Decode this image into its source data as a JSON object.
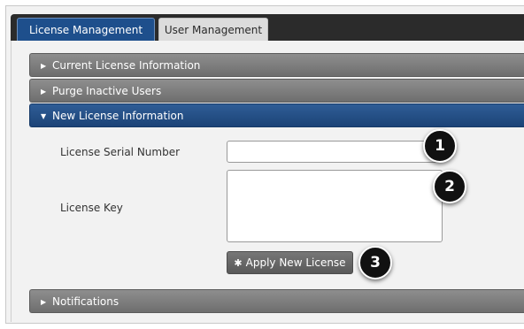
{
  "tabs": [
    {
      "label": "License Management"
    },
    {
      "label": "User Management"
    }
  ],
  "sections": [
    {
      "label": "Current License Information",
      "arrow": "▶"
    },
    {
      "label": "Purge Inactive Users",
      "arrow": "▶"
    },
    {
      "label": "New License Information",
      "arrow": "▼"
    },
    {
      "label": "Notifications",
      "arrow": "▶"
    }
  ],
  "form": {
    "serial_label": "License Serial Number",
    "serial_value": "",
    "key_label": "License Key",
    "key_value": "",
    "apply_label": "Apply New License",
    "apply_icon": "gear-icon",
    "apply_glyph": "✱"
  },
  "callouts": [
    "1",
    "2",
    "3"
  ]
}
